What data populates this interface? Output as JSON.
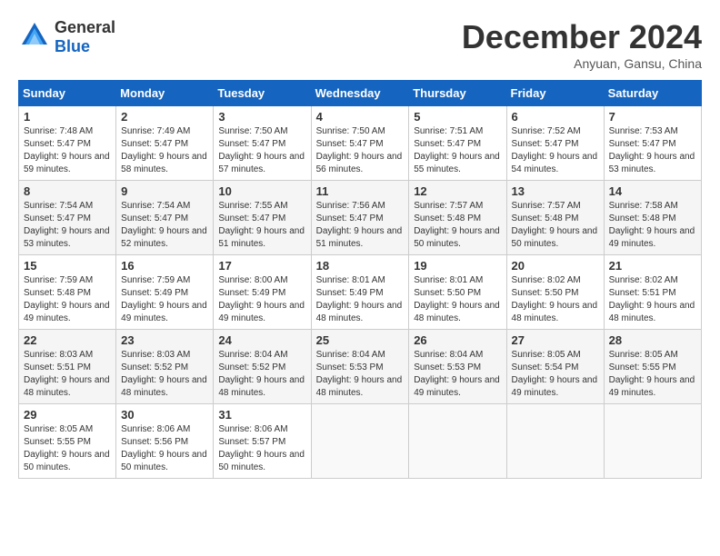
{
  "header": {
    "logo_general": "General",
    "logo_blue": "Blue",
    "title": "December 2024",
    "location": "Anyuan, Gansu, China"
  },
  "weekdays": [
    "Sunday",
    "Monday",
    "Tuesday",
    "Wednesday",
    "Thursday",
    "Friday",
    "Saturday"
  ],
  "weeks": [
    [
      {
        "day": "1",
        "sunrise": "Sunrise: 7:48 AM",
        "sunset": "Sunset: 5:47 PM",
        "daylight": "Daylight: 9 hours and 59 minutes."
      },
      {
        "day": "2",
        "sunrise": "Sunrise: 7:49 AM",
        "sunset": "Sunset: 5:47 PM",
        "daylight": "Daylight: 9 hours and 58 minutes."
      },
      {
        "day": "3",
        "sunrise": "Sunrise: 7:50 AM",
        "sunset": "Sunset: 5:47 PM",
        "daylight": "Daylight: 9 hours and 57 minutes."
      },
      {
        "day": "4",
        "sunrise": "Sunrise: 7:50 AM",
        "sunset": "Sunset: 5:47 PM",
        "daylight": "Daylight: 9 hours and 56 minutes."
      },
      {
        "day": "5",
        "sunrise": "Sunrise: 7:51 AM",
        "sunset": "Sunset: 5:47 PM",
        "daylight": "Daylight: 9 hours and 55 minutes."
      },
      {
        "day": "6",
        "sunrise": "Sunrise: 7:52 AM",
        "sunset": "Sunset: 5:47 PM",
        "daylight": "Daylight: 9 hours and 54 minutes."
      },
      {
        "day": "7",
        "sunrise": "Sunrise: 7:53 AM",
        "sunset": "Sunset: 5:47 PM",
        "daylight": "Daylight: 9 hours and 53 minutes."
      }
    ],
    [
      {
        "day": "8",
        "sunrise": "Sunrise: 7:54 AM",
        "sunset": "Sunset: 5:47 PM",
        "daylight": "Daylight: 9 hours and 53 minutes."
      },
      {
        "day": "9",
        "sunrise": "Sunrise: 7:54 AM",
        "sunset": "Sunset: 5:47 PM",
        "daylight": "Daylight: 9 hours and 52 minutes."
      },
      {
        "day": "10",
        "sunrise": "Sunrise: 7:55 AM",
        "sunset": "Sunset: 5:47 PM",
        "daylight": "Daylight: 9 hours and 51 minutes."
      },
      {
        "day": "11",
        "sunrise": "Sunrise: 7:56 AM",
        "sunset": "Sunset: 5:47 PM",
        "daylight": "Daylight: 9 hours and 51 minutes."
      },
      {
        "day": "12",
        "sunrise": "Sunrise: 7:57 AM",
        "sunset": "Sunset: 5:48 PM",
        "daylight": "Daylight: 9 hours and 50 minutes."
      },
      {
        "day": "13",
        "sunrise": "Sunrise: 7:57 AM",
        "sunset": "Sunset: 5:48 PM",
        "daylight": "Daylight: 9 hours and 50 minutes."
      },
      {
        "day": "14",
        "sunrise": "Sunrise: 7:58 AM",
        "sunset": "Sunset: 5:48 PM",
        "daylight": "Daylight: 9 hours and 49 minutes."
      }
    ],
    [
      {
        "day": "15",
        "sunrise": "Sunrise: 7:59 AM",
        "sunset": "Sunset: 5:48 PM",
        "daylight": "Daylight: 9 hours and 49 minutes."
      },
      {
        "day": "16",
        "sunrise": "Sunrise: 7:59 AM",
        "sunset": "Sunset: 5:49 PM",
        "daylight": "Daylight: 9 hours and 49 minutes."
      },
      {
        "day": "17",
        "sunrise": "Sunrise: 8:00 AM",
        "sunset": "Sunset: 5:49 PM",
        "daylight": "Daylight: 9 hours and 49 minutes."
      },
      {
        "day": "18",
        "sunrise": "Sunrise: 8:01 AM",
        "sunset": "Sunset: 5:49 PM",
        "daylight": "Daylight: 9 hours and 48 minutes."
      },
      {
        "day": "19",
        "sunrise": "Sunrise: 8:01 AM",
        "sunset": "Sunset: 5:50 PM",
        "daylight": "Daylight: 9 hours and 48 minutes."
      },
      {
        "day": "20",
        "sunrise": "Sunrise: 8:02 AM",
        "sunset": "Sunset: 5:50 PM",
        "daylight": "Daylight: 9 hours and 48 minutes."
      },
      {
        "day": "21",
        "sunrise": "Sunrise: 8:02 AM",
        "sunset": "Sunset: 5:51 PM",
        "daylight": "Daylight: 9 hours and 48 minutes."
      }
    ],
    [
      {
        "day": "22",
        "sunrise": "Sunrise: 8:03 AM",
        "sunset": "Sunset: 5:51 PM",
        "daylight": "Daylight: 9 hours and 48 minutes."
      },
      {
        "day": "23",
        "sunrise": "Sunrise: 8:03 AM",
        "sunset": "Sunset: 5:52 PM",
        "daylight": "Daylight: 9 hours and 48 minutes."
      },
      {
        "day": "24",
        "sunrise": "Sunrise: 8:04 AM",
        "sunset": "Sunset: 5:52 PM",
        "daylight": "Daylight: 9 hours and 48 minutes."
      },
      {
        "day": "25",
        "sunrise": "Sunrise: 8:04 AM",
        "sunset": "Sunset: 5:53 PM",
        "daylight": "Daylight: 9 hours and 48 minutes."
      },
      {
        "day": "26",
        "sunrise": "Sunrise: 8:04 AM",
        "sunset": "Sunset: 5:53 PM",
        "daylight": "Daylight: 9 hours and 49 minutes."
      },
      {
        "day": "27",
        "sunrise": "Sunrise: 8:05 AM",
        "sunset": "Sunset: 5:54 PM",
        "daylight": "Daylight: 9 hours and 49 minutes."
      },
      {
        "day": "28",
        "sunrise": "Sunrise: 8:05 AM",
        "sunset": "Sunset: 5:55 PM",
        "daylight": "Daylight: 9 hours and 49 minutes."
      }
    ],
    [
      {
        "day": "29",
        "sunrise": "Sunrise: 8:05 AM",
        "sunset": "Sunset: 5:55 PM",
        "daylight": "Daylight: 9 hours and 50 minutes."
      },
      {
        "day": "30",
        "sunrise": "Sunrise: 8:06 AM",
        "sunset": "Sunset: 5:56 PM",
        "daylight": "Daylight: 9 hours and 50 minutes."
      },
      {
        "day": "31",
        "sunrise": "Sunrise: 8:06 AM",
        "sunset": "Sunset: 5:57 PM",
        "daylight": "Daylight: 9 hours and 50 minutes."
      },
      null,
      null,
      null,
      null
    ]
  ]
}
